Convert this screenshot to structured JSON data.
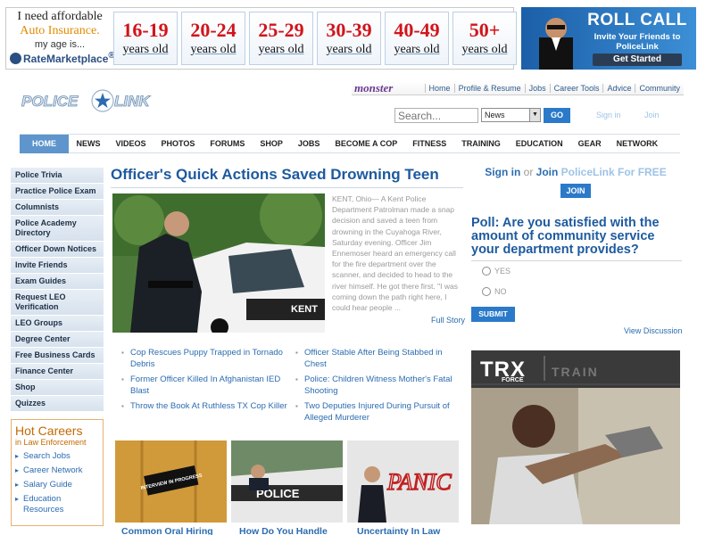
{
  "ad_banner": {
    "line1": "I need affordable",
    "line2": "Auto Insurance.",
    "line3": "my age is...",
    "brand": "RateMarketplace",
    "brand_mark": "®",
    "ages": [
      {
        "range": "16-19",
        "label": "years old"
      },
      {
        "range": "20-24",
        "label": "years old"
      },
      {
        "range": "25-29",
        "label": "years old"
      },
      {
        "range": "30-39",
        "label": "years old"
      },
      {
        "range": "40-49",
        "label": "years old"
      },
      {
        "range": "50+",
        "label": "years old"
      }
    ]
  },
  "roll_call_ad": {
    "title": "ROLL CALL",
    "subtitle": "Invite Your Friends to PoliceLink",
    "button": "Get Started"
  },
  "header": {
    "logo": "POLICE LINK",
    "monster_logo": "monster",
    "monster_links": [
      "Home",
      "Profile & Resume",
      "Jobs",
      "Career Tools",
      "Advice",
      "Community"
    ],
    "search_placeholder": "Search...",
    "search_scope": "News",
    "go": "GO",
    "sign_in": "Sign in",
    "join": "Join"
  },
  "nav": [
    "HOME",
    "NEWS",
    "VIDEOS",
    "PHOTOS",
    "FORUMS",
    "SHOP",
    "JOBS",
    "BECOME A COP",
    "FITNESS",
    "TRAINING",
    "EDUCATION",
    "GEAR",
    "NETWORK"
  ],
  "sidebar": {
    "items": [
      "Police Trivia",
      "Practice Police Exam",
      "Columnists",
      "Police Academy Directory",
      "Officer Down Notices",
      "Invite Friends",
      "Exam Guides",
      "Request LEO Verification",
      "LEO Groups",
      "Degree Center",
      "Free Business Cards",
      "Finance Center",
      "Shop",
      "Quizzes"
    ]
  },
  "hot_careers": {
    "title": "Hot Careers",
    "subtitle": "in Law Enforcement",
    "links": [
      "Search Jobs",
      "Career Network",
      "Salary Guide",
      "Education Resources"
    ]
  },
  "feature": {
    "headline": "Officer's Quick Actions Saved Drowning Teen",
    "excerpt": "KENT, Ohio— A Kent Police Department Patrolman made a snap decision and saved a teen from drowning in the Cuyahoga River, Saturday evening. Officer Jim Ennemoser heard an emergency call for the fire department over the scanner, and decided to head to the river himself. He got there first. \"I was coming down the path right here, I could hear people ...",
    "full_story": "Full Story",
    "car_text": "KENT"
  },
  "stories": [
    [
      "Cop Rescues Puppy Trapped in Tornado Debris",
      "Officer Stable After Being Stabbed in Chest"
    ],
    [
      "Former Officer Killed In Afghanistan IED Blast",
      "Police: Children Witness Mother's Fatal Shooting"
    ],
    [
      "Throw the Book At Ruthless TX Cop Killer",
      "Two Deputies Injured During Pursuit of Alleged Murderer"
    ]
  ],
  "thumbs": [
    {
      "caption": "Common Oral Hiring",
      "sign": "INTERVIEW IN PROGRESS"
    },
    {
      "caption": "How Do You Handle",
      "sign": "POLICE"
    },
    {
      "caption": "Uncertainty In Law",
      "sign": "PANIC"
    }
  ],
  "right": {
    "sign_in": "Sign in",
    "or": "or",
    "join": "Join",
    "rest": "PoliceLink For FREE",
    "join_button": "JOIN",
    "poll_question": "Poll: Are you satisfied with the amount of community service your department provides?",
    "options": [
      "YES",
      "NO"
    ],
    "submit": "SUBMIT",
    "view_discussion": "View Discussion",
    "trx_logo": "TRX",
    "trx_force": "FORCE",
    "trx_train": "TRAIN"
  },
  "colors": {
    "link_blue": "#2b6cb0",
    "headline_blue": "#1d5a9e",
    "age_red": "#d1141b",
    "nav_active": "#5e95cc",
    "button_blue": "#2b7ac9",
    "careers_orange": "#c36a00"
  }
}
